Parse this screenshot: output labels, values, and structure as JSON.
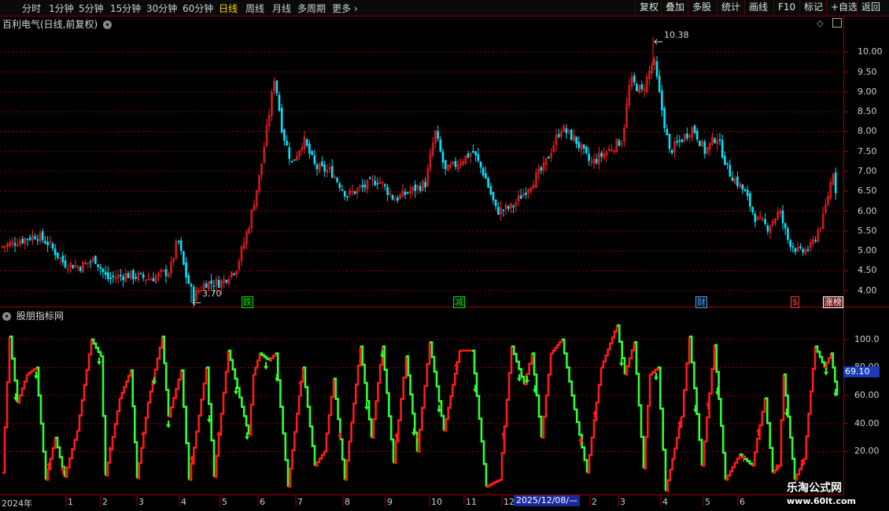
{
  "toolbar": {
    "periods": [
      {
        "label": "分时",
        "active": false
      },
      {
        "label": "1分钟",
        "active": false
      },
      {
        "label": "5分钟",
        "active": false
      },
      {
        "label": "15分钟",
        "active": false
      },
      {
        "label": "30分钟",
        "active": false
      },
      {
        "label": "60分钟",
        "active": false
      },
      {
        "label": "日线",
        "active": true
      },
      {
        "label": "周线",
        "active": false
      },
      {
        "label": "月线",
        "active": false
      },
      {
        "label": "多周期",
        "active": false
      }
    ],
    "more_label": "更多",
    "right_buttons": [
      "复权",
      "叠加",
      "多股",
      "统计",
      "画线",
      "F10",
      "标记",
      "+自选",
      "返回"
    ]
  },
  "chart_header": {
    "stock_title": "百利电气(日线,前复权)"
  },
  "indicator_header": {
    "name": "股朋指标网"
  },
  "price_axis": {
    "ticks": [
      "10.00",
      "9.50",
      "9.00",
      "8.50",
      "8.00",
      "7.50",
      "7.00",
      "6.50",
      "6.00",
      "5.50",
      "5.00",
      "4.50",
      "4.00"
    ]
  },
  "indicator_axis": {
    "ticks": [
      "100.0",
      "80.00",
      "60.00",
      "40.00",
      "20.00"
    ],
    "current_value": "69.10"
  },
  "annotations": {
    "high": "10.38",
    "low": "3.70"
  },
  "event_badges": [
    {
      "label": "跌",
      "color": "#00e000"
    },
    {
      "label": "减",
      "color": "#00e000"
    },
    {
      "label": "财",
      "color": "#4aa0ff"
    },
    {
      "label": "$",
      "color": "#ff3030"
    },
    {
      "label": "涨榜",
      "color": "#ffffff"
    }
  ],
  "time_axis": {
    "year_label": "2024年",
    "months": [
      "1",
      "2",
      "3",
      "4",
      "5",
      "6",
      "7",
      "8",
      "9",
      "10",
      "11",
      "12",
      "2",
      "3",
      "4",
      "5",
      "6"
    ],
    "cursor_date": "2025/12/08/—"
  },
  "watermark": {
    "title": "乐淘公式网",
    "url": "www.60lt.com"
  },
  "colors": {
    "up": "#ff2020",
    "down": "#00e5ff",
    "indicator_up": "#ff1a1a",
    "indicator_down": "#30ff30",
    "grid": "#8b0000"
  },
  "chart_data": [
    {
      "type": "candlestick",
      "ylim": [
        3.6,
        10.6
      ],
      "close_path": [
        [
          0,
          5.1
        ],
        [
          30,
          5.3
        ],
        [
          45,
          5.4
        ],
        [
          60,
          5.2
        ],
        [
          80,
          4.7
        ],
        [
          100,
          4.6
        ],
        [
          120,
          4.8
        ],
        [
          135,
          4.3
        ],
        [
          160,
          4.4
        ],
        [
          190,
          4.3
        ],
        [
          215,
          4.5
        ],
        [
          225,
          5.3
        ],
        [
          235,
          4.4
        ],
        [
          245,
          3.85
        ],
        [
          260,
          4.2
        ],
        [
          280,
          4.2
        ],
        [
          300,
          4.6
        ],
        [
          315,
          5.6
        ],
        [
          330,
          7.0
        ],
        [
          340,
          8.3
        ],
        [
          348,
          9.4
        ],
        [
          358,
          8.0
        ],
        [
          370,
          7.2
        ],
        [
          385,
          7.8
        ],
        [
          400,
          7.1
        ],
        [
          420,
          7.0
        ],
        [
          440,
          6.4
        ],
        [
          460,
          6.6
        ],
        [
          480,
          6.8
        ],
        [
          500,
          6.3
        ],
        [
          520,
          6.5
        ],
        [
          540,
          6.7
        ],
        [
          552,
          8.0
        ],
        [
          565,
          7.0
        ],
        [
          580,
          7.2
        ],
        [
          600,
          7.5
        ],
        [
          615,
          6.9
        ],
        [
          630,
          6.0
        ],
        [
          650,
          6.1
        ],
        [
          670,
          6.6
        ],
        [
          690,
          7.1
        ],
        [
          712,
          8.1
        ],
        [
          730,
          7.8
        ],
        [
          750,
          7.2
        ],
        [
          770,
          7.5
        ],
        [
          790,
          7.8
        ],
        [
          800,
          9.3
        ],
        [
          815,
          9.0
        ],
        [
          830,
          9.8
        ],
        [
          840,
          8.6
        ],
        [
          850,
          7.5
        ],
        [
          865,
          7.8
        ],
        [
          880,
          8.1
        ],
        [
          895,
          7.5
        ],
        [
          910,
          7.9
        ],
        [
          925,
          7.0
        ],
        [
          945,
          6.5
        ],
        [
          960,
          5.8
        ],
        [
          975,
          5.6
        ],
        [
          990,
          6.0
        ],
        [
          1000,
          5.3
        ],
        [
          1015,
          4.95
        ],
        [
          1030,
          5.1
        ],
        [
          1045,
          5.8
        ],
        [
          1058,
          7.0
        ],
        [
          1063,
          6.3
        ]
      ]
    },
    {
      "type": "line",
      "name": "股朋指标网",
      "ylim": [
        -10,
        115
      ],
      "turning_points": [
        [
          3,
          5
        ],
        [
          12,
          102
        ],
        [
          22,
          55
        ],
        [
          34,
          75
        ],
        [
          46,
          80
        ],
        [
          58,
          0
        ],
        [
          70,
          30
        ],
        [
          82,
          2
        ],
        [
          98,
          35
        ],
        [
          116,
          100
        ],
        [
          128,
          88
        ],
        [
          134,
          3
        ],
        [
          152,
          58
        ],
        [
          166,
          78
        ],
        [
          174,
          1
        ],
        [
          188,
          55
        ],
        [
          206,
          102
        ],
        [
          214,
          45
        ],
        [
          230,
          78
        ],
        [
          240,
          0
        ],
        [
          262,
          80
        ],
        [
          272,
          2
        ],
        [
          290,
          92
        ],
        [
          316,
          32
        ],
        [
          322,
          75
        ],
        [
          330,
          90
        ],
        [
          342,
          85
        ],
        [
          350,
          90
        ],
        [
          366,
          -5
        ],
        [
          380,
          60
        ],
        [
          385,
          80
        ],
        [
          400,
          10
        ],
        [
          412,
          20
        ],
        [
          424,
          72
        ],
        [
          438,
          0
        ],
        [
          458,
          95
        ],
        [
          472,
          30
        ],
        [
          486,
          95
        ],
        [
          500,
          12
        ],
        [
          516,
          88
        ],
        [
          530,
          20
        ],
        [
          546,
          98
        ],
        [
          564,
          35
        ],
        [
          584,
          92
        ],
        [
          600,
          92
        ],
        [
          618,
          -5
        ],
        [
          635,
          0
        ],
        [
          650,
          95
        ],
        [
          666,
          68
        ],
        [
          676,
          90
        ],
        [
          688,
          30
        ],
        [
          700,
          90
        ],
        [
          714,
          100
        ],
        [
          730,
          50
        ],
        [
          746,
          5
        ],
        [
          764,
          80
        ],
        [
          784,
          110
        ],
        [
          794,
          75
        ],
        [
          806,
          98
        ],
        [
          818,
          8
        ],
        [
          826,
          75
        ],
        [
          836,
          80
        ],
        [
          846,
          -8
        ],
        [
          866,
          45
        ],
        [
          876,
          102
        ],
        [
          892,
          10
        ],
        [
          908,
          96
        ],
        [
          922,
          0
        ],
        [
          940,
          18
        ],
        [
          956,
          10
        ],
        [
          972,
          58
        ],
        [
          982,
          5
        ],
        [
          990,
          10
        ],
        [
          996,
          75
        ],
        [
          1010,
          0
        ],
        [
          1022,
          15
        ],
        [
          1036,
          95
        ],
        [
          1048,
          80
        ],
        [
          1056,
          90
        ],
        [
          1064,
          60
        ]
      ],
      "arrows_up": [
        62,
        80,
        140,
        182,
        244,
        278,
        382,
        432,
        504,
        532,
        580,
        640,
        738,
        756,
        864,
        900,
        945,
        964,
        988,
        1020
      ],
      "arrows_down": [
        20,
        46,
        126,
        196,
        214,
        266,
        300,
        314,
        338,
        352,
        466,
        486,
        526,
        558,
        604,
        660,
        670,
        680,
        790,
        834,
        884,
        912,
        1000,
        1050,
        1062
      ]
    }
  ]
}
